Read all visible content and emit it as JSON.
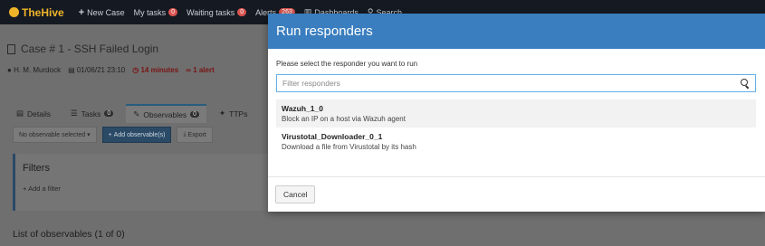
{
  "navbar": {
    "brand": "TheHive",
    "new_case": "New Case",
    "my_tasks": "My tasks",
    "my_tasks_count": "0",
    "waiting_tasks": "Waiting tasks",
    "waiting_tasks_count": "0",
    "alerts": "Alerts",
    "alerts_count": "263",
    "dashboards": "Dashboards",
    "search": "Search"
  },
  "case": {
    "title": "Case # 1 - SSH Failed Login",
    "owner": "H. M. Murdock",
    "date": "01/06/21 23:10",
    "duration": "14 minutes",
    "alerts": "1 alert"
  },
  "tabs": [
    {
      "label": "Details"
    },
    {
      "label": "Tasks",
      "count": "0"
    },
    {
      "label": "Observables",
      "count": "0"
    },
    {
      "label": "TTPs"
    }
  ],
  "observables": {
    "selection": "No observable selected",
    "add_button": "Add observable(s)",
    "export_button": "Export",
    "filters_title": "Filters",
    "add_filter": "Add a filter",
    "list_title": "List of observables (1 of 0)"
  },
  "modal": {
    "title": "Run responders",
    "intro": "Please select the responder you want to run",
    "search_placeholder": "Filter responders",
    "responders": [
      {
        "name": "Wazuh_1_0",
        "description": "Block an IP on a host via Wazuh agent"
      },
      {
        "name": "Virustotal_Downloader_0_1",
        "description": "Download a file from Virustotal by its hash"
      }
    ],
    "cancel_label": "Cancel"
  }
}
